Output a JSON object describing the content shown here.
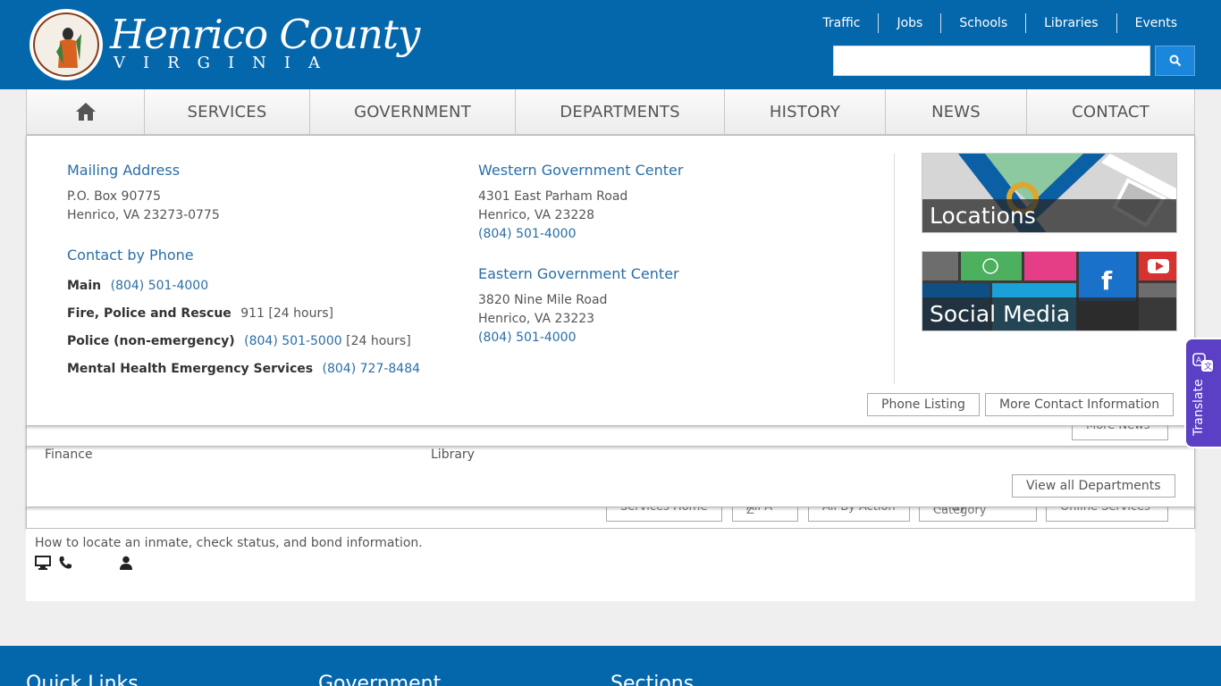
{
  "header": {
    "logo_name": "Henrico County",
    "logo_state": "VIRGINIA",
    "seal_text": "COUNTY OF HENRICO, VIRGINIA",
    "top_links": [
      "Traffic",
      "Jobs",
      "Schools",
      "Libraries",
      "Events"
    ],
    "search": {
      "value": "",
      "placeholder": ""
    }
  },
  "nav": {
    "items": [
      "SERVICES",
      "GOVERNMENT",
      "DEPARTMENTS",
      "HISTORY",
      "NEWS",
      "CONTACT"
    ]
  },
  "contact": {
    "mailing": {
      "heading": "Mailing Address",
      "line1": "P.O. Box 90775",
      "line2": "Henrico, VA 23273-0775"
    },
    "phone": {
      "heading": "Contact by Phone",
      "rows": [
        {
          "label": "Main",
          "number": "(804) 501-4000",
          "note": ""
        },
        {
          "label": "Fire, Police and Rescue",
          "number": "",
          "plain": "911",
          "note": "[24 hours]"
        },
        {
          "label": "Police (non-emergency)",
          "number": "(804) 501-5000",
          "note": "[24 hours]"
        },
        {
          "label": "Mental Health Emergency Services",
          "number": "(804) 727-8484",
          "note": ""
        }
      ]
    },
    "western": {
      "heading": "Western Government Center",
      "line1": "4301 East Parham Road",
      "line2": "Henrico, VA 23228",
      "phone": "(804) 501-4000"
    },
    "eastern": {
      "heading": "Eastern Government Center",
      "line1": "3820 Nine Mile Road",
      "line2": "Henrico, VA 23223",
      "phone": "(804) 501-4000"
    },
    "tiles": {
      "locations": "Locations",
      "social": "Social Media"
    },
    "buttons": {
      "phone_listing": "Phone Listing",
      "more_contact": "More Contact Information"
    }
  },
  "behind": {
    "news_button": "More News",
    "departments": [
      "Finance",
      "Library"
    ],
    "view_all_departments": "View all Departments",
    "service_buttons": [
      "Services Home",
      "All A-Z",
      "All By Action",
      "All By Category",
      "Online Services"
    ]
  },
  "content": {
    "description": "How to locate an inmate, check status, and bond information."
  },
  "footer": {
    "headings": [
      "Quick Links",
      "Government",
      "Sections"
    ]
  },
  "translate": {
    "label": "Translate"
  },
  "colors": {
    "header_blue": "#0466ab",
    "link_blue": "#2a6ea6",
    "search_button": "#1b87dc",
    "translate_purple": "#5b3fc4"
  }
}
